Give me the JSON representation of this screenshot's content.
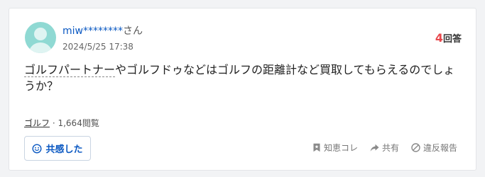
{
  "user": {
    "name": "miw********",
    "suffix": "さん",
    "posted_at": "2024/5/25 17:38"
  },
  "answers": {
    "count": "4",
    "label": "回答"
  },
  "question": {
    "lead": "ゴルフパートナー",
    "rest": "やゴルフドゥなどはゴルフの距離計など買取してもらえるのでしょうか？"
  },
  "meta": {
    "category": "ゴルフ",
    "separator": " · ",
    "views": "1,664閲覧"
  },
  "buttons": {
    "empathy": "共感した"
  },
  "actions": {
    "bookmark": "知恵コレ",
    "share": "共有",
    "report": "違反報告"
  },
  "colors": {
    "link_blue": "#0a58c2",
    "answer_count_red": "#e8474c",
    "avatar_teal": "#8fd9d3"
  },
  "icons": [
    "avatar-icon",
    "smile-icon",
    "bookmark-icon",
    "share-icon",
    "report-icon"
  ]
}
